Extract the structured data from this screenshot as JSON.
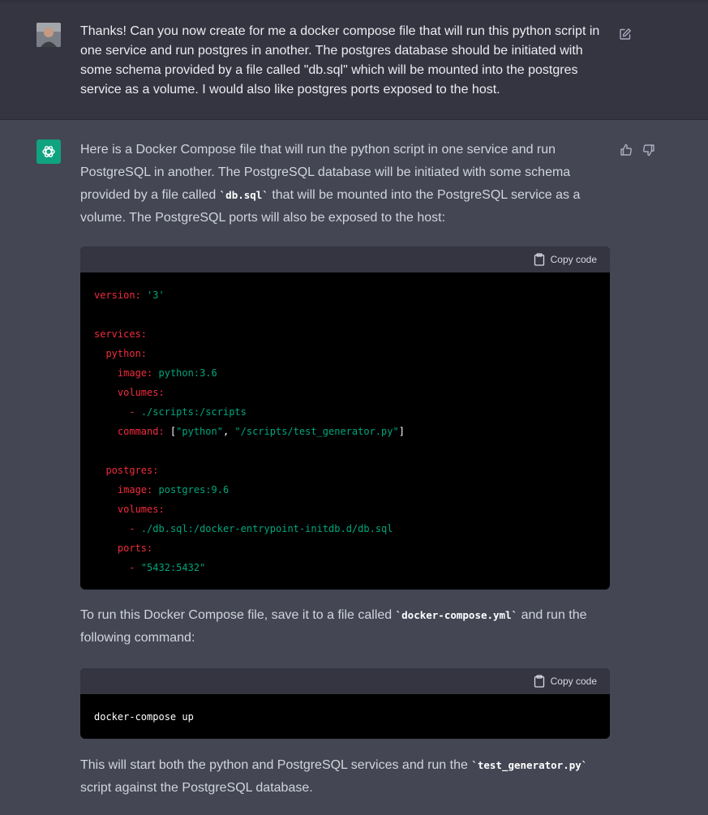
{
  "user_message": {
    "avatar_alt": "user avatar",
    "lines": [
      "Thanks! Can you now create for me a docker compose file that will run this python script in",
      "one service and run postgres in another. The postgres database should be initiated with",
      "some schema provided by a file called \"db.sql\" which will be mounted into the postgres",
      "service as a volume. I would also like postgres ports exposed to the host."
    ]
  },
  "assistant_message": {
    "intro": {
      "a": "Here is a Docker Compose file that will run the python script in one service and run PostgreSQL in another. The PostgreSQL database will be initiated with some schema provided by a file called ",
      "code": "`db.sql`",
      "b": " that will be mounted into the PostgreSQL service as a volume. The PostgreSQL ports will also be exposed to the host:"
    },
    "code_block_1": {
      "copy_label": "Copy code",
      "lines": [
        [
          {
            "t": "k",
            "v": "version:"
          },
          {
            "t": "w",
            "v": " "
          },
          {
            "t": "s",
            "v": "'3'"
          }
        ],
        [],
        [
          {
            "t": "k",
            "v": "services:"
          }
        ],
        [
          {
            "t": "w",
            "v": "  "
          },
          {
            "t": "k",
            "v": "python:"
          }
        ],
        [
          {
            "t": "w",
            "v": "    "
          },
          {
            "t": "k",
            "v": "image:"
          },
          {
            "t": "w",
            "v": " "
          },
          {
            "t": "s",
            "v": "python:3.6"
          }
        ],
        [
          {
            "t": "w",
            "v": "    "
          },
          {
            "t": "k",
            "v": "volumes:"
          }
        ],
        [
          {
            "t": "w",
            "v": "      "
          },
          {
            "t": "k",
            "v": "-"
          },
          {
            "t": "w",
            "v": " "
          },
          {
            "t": "s",
            "v": "./scripts:/scripts"
          }
        ],
        [
          {
            "t": "w",
            "v": "    "
          },
          {
            "t": "k",
            "v": "command:"
          },
          {
            "t": "w",
            "v": " ["
          },
          {
            "t": "s",
            "v": "\"python\""
          },
          {
            "t": "w",
            "v": ", "
          },
          {
            "t": "s",
            "v": "\"/scripts/test_generator.py\""
          },
          {
            "t": "w",
            "v": "]"
          }
        ],
        [],
        [
          {
            "t": "w",
            "v": "  "
          },
          {
            "t": "k",
            "v": "postgres:"
          }
        ],
        [
          {
            "t": "w",
            "v": "    "
          },
          {
            "t": "k",
            "v": "image:"
          },
          {
            "t": "w",
            "v": " "
          },
          {
            "t": "s",
            "v": "postgres:9.6"
          }
        ],
        [
          {
            "t": "w",
            "v": "    "
          },
          {
            "t": "k",
            "v": "volumes:"
          }
        ],
        [
          {
            "t": "w",
            "v": "      "
          },
          {
            "t": "k",
            "v": "-"
          },
          {
            "t": "w",
            "v": " "
          },
          {
            "t": "s",
            "v": "./db.sql:/docker-entrypoint-initdb.d/db.sql"
          }
        ],
        [
          {
            "t": "w",
            "v": "    "
          },
          {
            "t": "k",
            "v": "ports:"
          }
        ],
        [
          {
            "t": "w",
            "v": "      "
          },
          {
            "t": "k",
            "v": "-"
          },
          {
            "t": "w",
            "v": " "
          },
          {
            "t": "s",
            "v": "\"5432:5432\""
          }
        ]
      ]
    },
    "para2": {
      "a": "To run this Docker Compose file, save it to a file called ",
      "code": "`docker-compose.yml`",
      "b": " and run the following command:"
    },
    "code_block_2": {
      "copy_label": "Copy code",
      "text": "docker-compose up"
    },
    "para3": {
      "a": "This will start both the python and PostgreSQL services and run the ",
      "code": "`test_generator.py`",
      "b": " script against the PostgreSQL database."
    }
  },
  "colors": {
    "user_bg": "#343541",
    "assistant_bg": "#444654",
    "bot_avatar": "#10a37f",
    "code_key": "#f22c3d",
    "code_string": "#00a67d"
  },
  "icons": {
    "edit": "pencil-square-icon",
    "like": "thumbs-up-icon",
    "dislike": "thumbs-down-icon",
    "copy": "clipboard-icon",
    "bot": "openai-logo-icon"
  }
}
